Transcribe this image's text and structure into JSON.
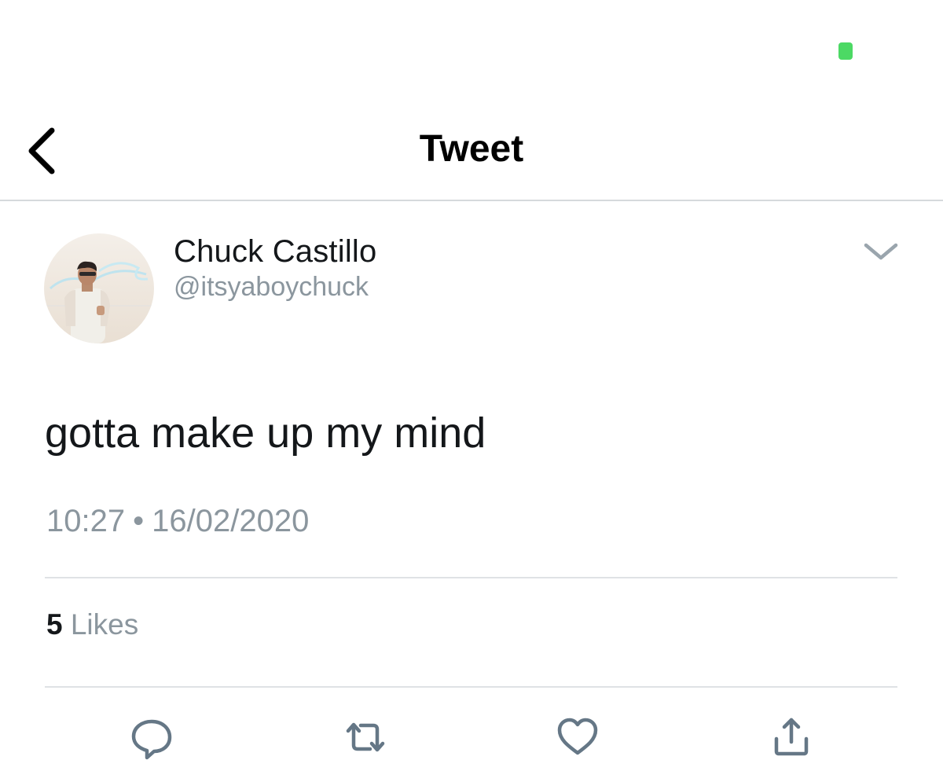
{
  "status_bar": {
    "battery_color": "#4cd964"
  },
  "nav": {
    "back_icon": "chevron-left-icon",
    "title": "Tweet"
  },
  "tweet": {
    "author": {
      "display_name": "Chuck Castillo",
      "handle": "@itsyaboychuck",
      "avatar": "profile-photo"
    },
    "more_icon": "chevron-down-icon",
    "text": "gotta make up my mind",
    "time": "10:27",
    "separator": "•",
    "date": "16/02/2020",
    "likes": {
      "count": "5",
      "label": "Likes"
    },
    "actions": {
      "reply_icon": "reply-icon",
      "retweet_icon": "retweet-icon",
      "like_icon": "heart-icon",
      "share_icon": "share-icon"
    }
  },
  "colors": {
    "text_primary": "#14171a",
    "text_secondary": "#8b969e",
    "divider": "#dfe2e5",
    "icon": "#657786"
  }
}
